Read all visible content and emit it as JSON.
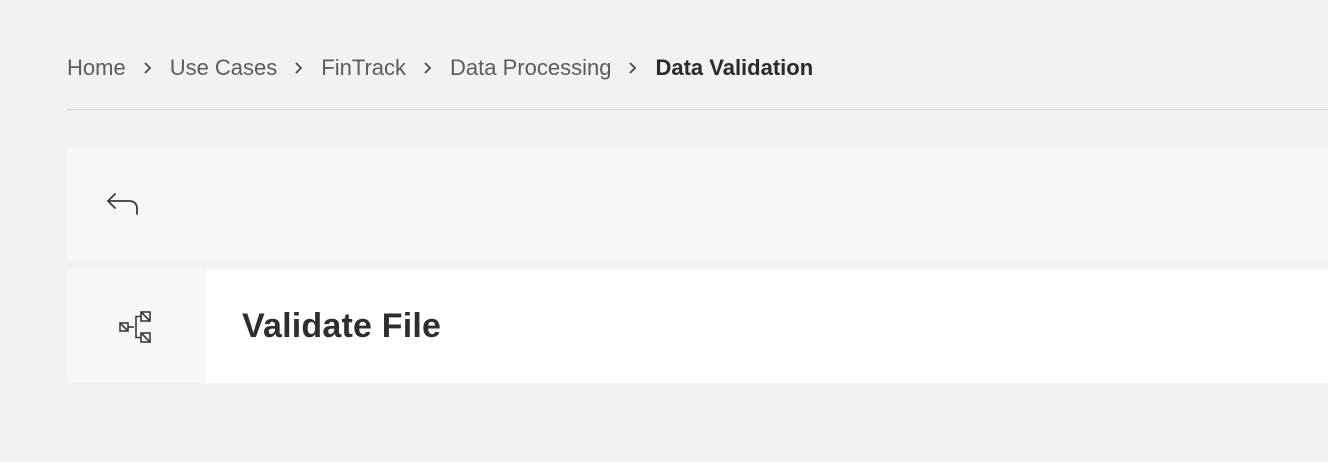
{
  "breadcrumb": {
    "items": [
      {
        "label": "Home"
      },
      {
        "label": "Use Cases"
      },
      {
        "label": "FinTrack"
      },
      {
        "label": "Data Processing"
      },
      {
        "label": "Data Validation"
      }
    ],
    "separator": "›"
  },
  "back_bar": {
    "icon": "back-arrow-icon"
  },
  "step": {
    "icon": "workflow-node-icon",
    "title": "Validate File"
  }
}
